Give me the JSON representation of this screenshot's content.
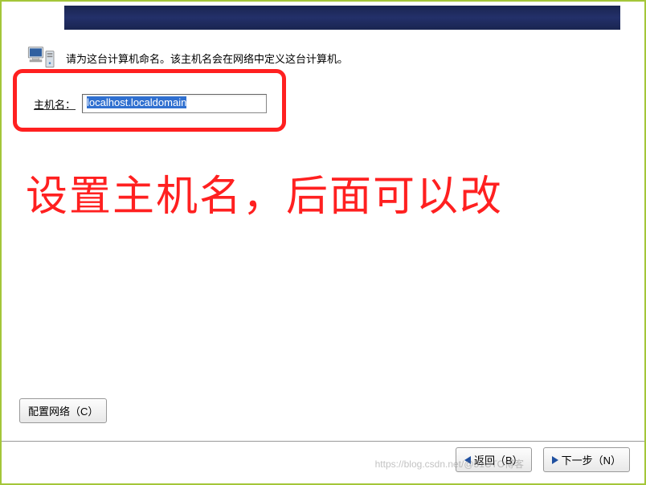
{
  "instruction": "请为这台计算机命名。该主机名会在网络中定义这台计算机。",
  "hostname": {
    "label": "主机名：",
    "value": "localhost.localdomain"
  },
  "annotation": "设置主机名，后面可以改",
  "buttons": {
    "config_network": "配置网络（C）",
    "back": "返回（B）",
    "next": "下一步（N）"
  },
  "watermark": "https://blog.csdn.net/@51CTO博客"
}
